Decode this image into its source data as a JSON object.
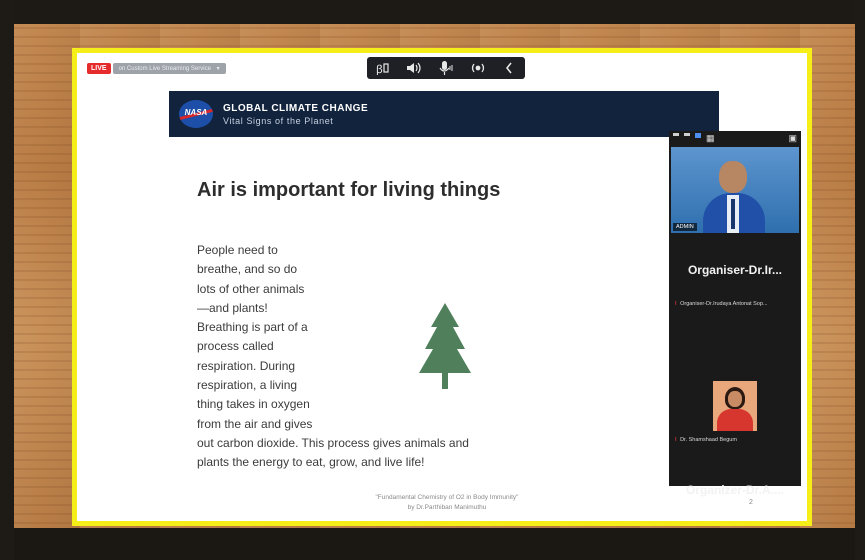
{
  "stream": {
    "live_badge": "LIVE",
    "label": "on Custom Live Streaming Service",
    "dropdown": "▾"
  },
  "toolbar": {
    "icons": [
      "participants-icon",
      "speaker-icon",
      "microphone-icon",
      "broadcast-icon",
      "collapse-icon"
    ]
  },
  "banner": {
    "logo_text": "NASA",
    "title": "GLOBAL CLIMATE CHANGE",
    "subtitle": "Vital Signs of the Planet"
  },
  "slide": {
    "heading": "Air is important for living things",
    "body_lines": [
      "People need to",
      "breathe, and so do",
      "lots of other animals",
      "—and plants!",
      "Breathing is part of a",
      "process called",
      "respiration. During",
      "respiration, a living",
      "thing takes in oxygen",
      "from the air and gives",
      "out carbon dioxide. This process gives animals and",
      "plants the energy to eat, grow, and live life!"
    ],
    "footnote_line1": "\"Fundamental Chemistry of O2 in Body Immunity\"",
    "footnote_line2": "by Dr.Parthiban Manimuthu",
    "page_number": "2"
  },
  "panel": {
    "video1_tag": "ADMIN",
    "organiser1_name": "Organiser-Dr.Ir...",
    "organiser1_full": "Organiser-Dr.Irudaya Antonat Sop...",
    "participant2_name": "Dr. Shamshaad Begum",
    "organiser2_name": "Organizer-Dr.A...."
  },
  "colors": {
    "frame_border": "#f6ee18",
    "banner_bg": "#12233e",
    "live_red": "#e52b2b",
    "panel_bg": "#1a1a1a",
    "tree_green": "#4f7f5b"
  }
}
